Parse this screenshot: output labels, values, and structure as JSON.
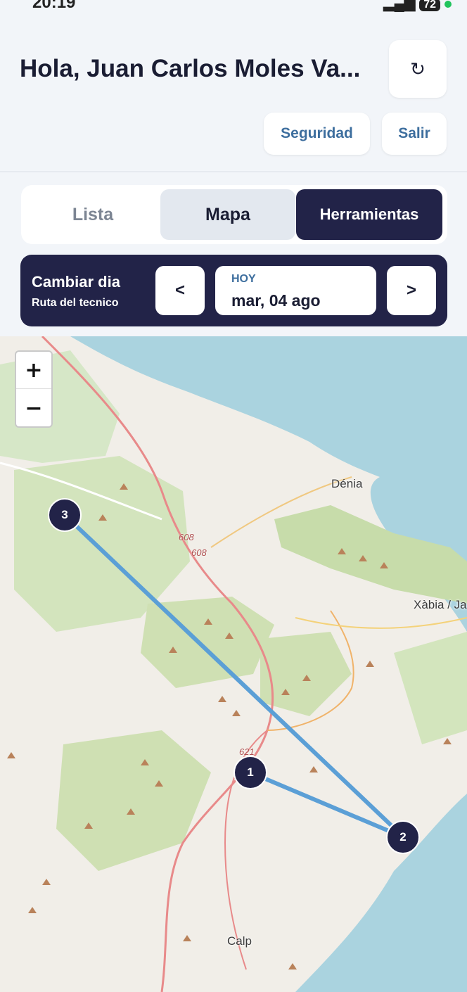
{
  "status": {
    "time": "20:19",
    "battery": "72"
  },
  "header": {
    "greeting": "Hola, Juan Carlos Moles Va...",
    "refresh_icon": "↻"
  },
  "actions": {
    "security_label": "Seguridad",
    "logout_label": "Salir"
  },
  "tabs": [
    {
      "label": "Lista",
      "active": false
    },
    {
      "label": "Mapa",
      "active": true
    },
    {
      "label": "Herramientas",
      "active": false
    }
  ],
  "day_selector": {
    "title": "Cambiar dia",
    "subtitle": "Ruta del tecnico",
    "prev_label": "<",
    "next_label": ">",
    "date_tag": "HOY",
    "date_value": "mar, 04 ago"
  },
  "map": {
    "zoom_in": "+",
    "zoom_out": "−",
    "places": [
      "Dénia",
      "Xàbia / Ja",
      "Calp"
    ],
    "road_numbers": [
      "608",
      "608",
      "621"
    ],
    "route_color": "#5b9fd6",
    "markers": [
      "3",
      "1",
      "2"
    ]
  }
}
